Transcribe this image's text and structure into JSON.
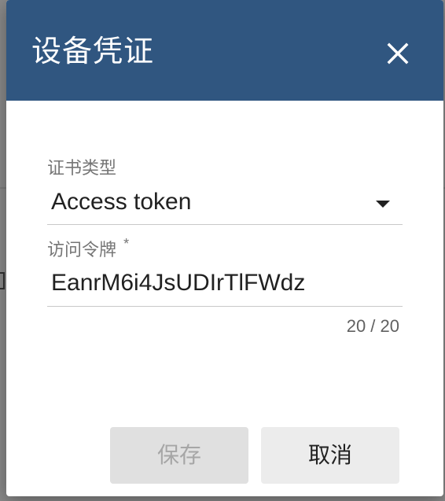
{
  "dialog": {
    "title": "设备凭证",
    "close_icon": "close-icon"
  },
  "credential_type": {
    "label": "证书类型",
    "value": "Access token",
    "icon": "dropdown-arrow-icon"
  },
  "access_token": {
    "label": "访问令牌",
    "required_mark": "*",
    "value": "EanrM6i4JsUDIrTlFWdz",
    "counter": "20 / 20"
  },
  "actions": {
    "save_label": "保存",
    "cancel_label": "取消"
  },
  "colors": {
    "header": "#305680",
    "save_disabled_bg": "#e0e0e0",
    "cancel_bg": "#ececec"
  }
}
